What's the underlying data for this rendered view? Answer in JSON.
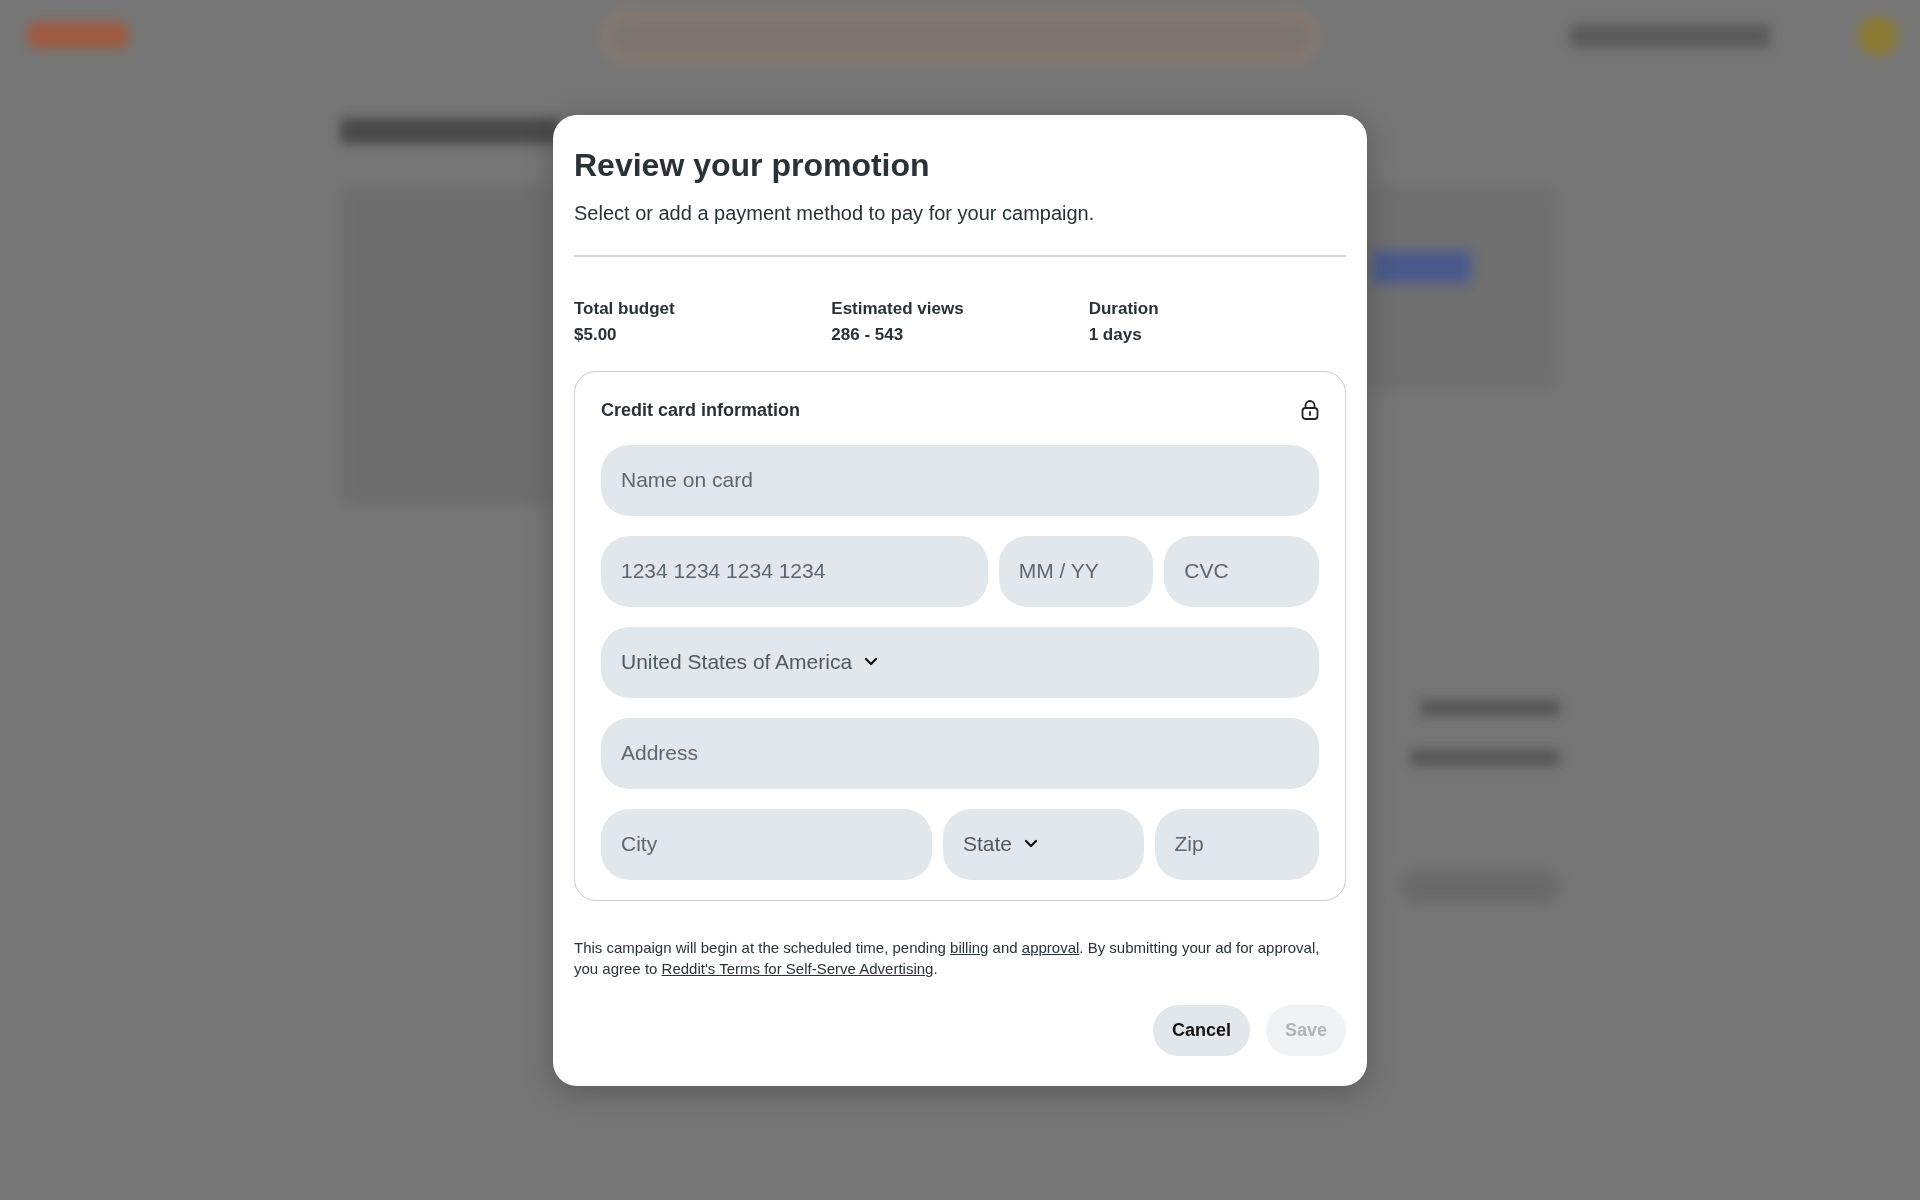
{
  "dialog": {
    "title": "Review your promotion",
    "subtitle": "Select or add a payment method to pay for your campaign.",
    "summary": [
      {
        "label": "Total budget",
        "value": "$5.00"
      },
      {
        "label": "Estimated views",
        "value": "286 - 543"
      },
      {
        "label": "Duration",
        "value": "1 days"
      }
    ],
    "card": {
      "title": "Credit card information",
      "rows": [
        [
          {
            "kind": "text",
            "placeholder": "Name on card"
          }
        ],
        [
          {
            "kind": "text",
            "placeholder": "1234 1234 1234 1234"
          },
          {
            "kind": "text",
            "placeholder": "MM / YY"
          },
          {
            "kind": "text",
            "placeholder": "CVC"
          }
        ],
        [
          {
            "kind": "select",
            "value": "United States of America"
          }
        ],
        [
          {
            "kind": "text",
            "placeholder": "Address"
          }
        ],
        [
          {
            "kind": "text",
            "placeholder": "City"
          },
          {
            "kind": "select",
            "value": "State"
          },
          {
            "kind": "text",
            "placeholder": "Zip"
          }
        ]
      ]
    },
    "terms": [
      {
        "kind": "text",
        "text": "This campaign will begin at the scheduled time, pending "
      },
      {
        "kind": "link",
        "text": "billing"
      },
      {
        "kind": "text",
        "text": " and "
      },
      {
        "kind": "link",
        "text": "approval"
      },
      {
        "kind": "text",
        "text": ". By submitting your ad for approval, you agree to "
      },
      {
        "kind": "link",
        "text": "Reddit's Terms for Self-Serve Advertising"
      },
      {
        "kind": "text",
        "text": "."
      }
    ],
    "buttons": [
      {
        "label": "Cancel",
        "disabled": false
      },
      {
        "label": "Save",
        "disabled": true
      }
    ]
  }
}
